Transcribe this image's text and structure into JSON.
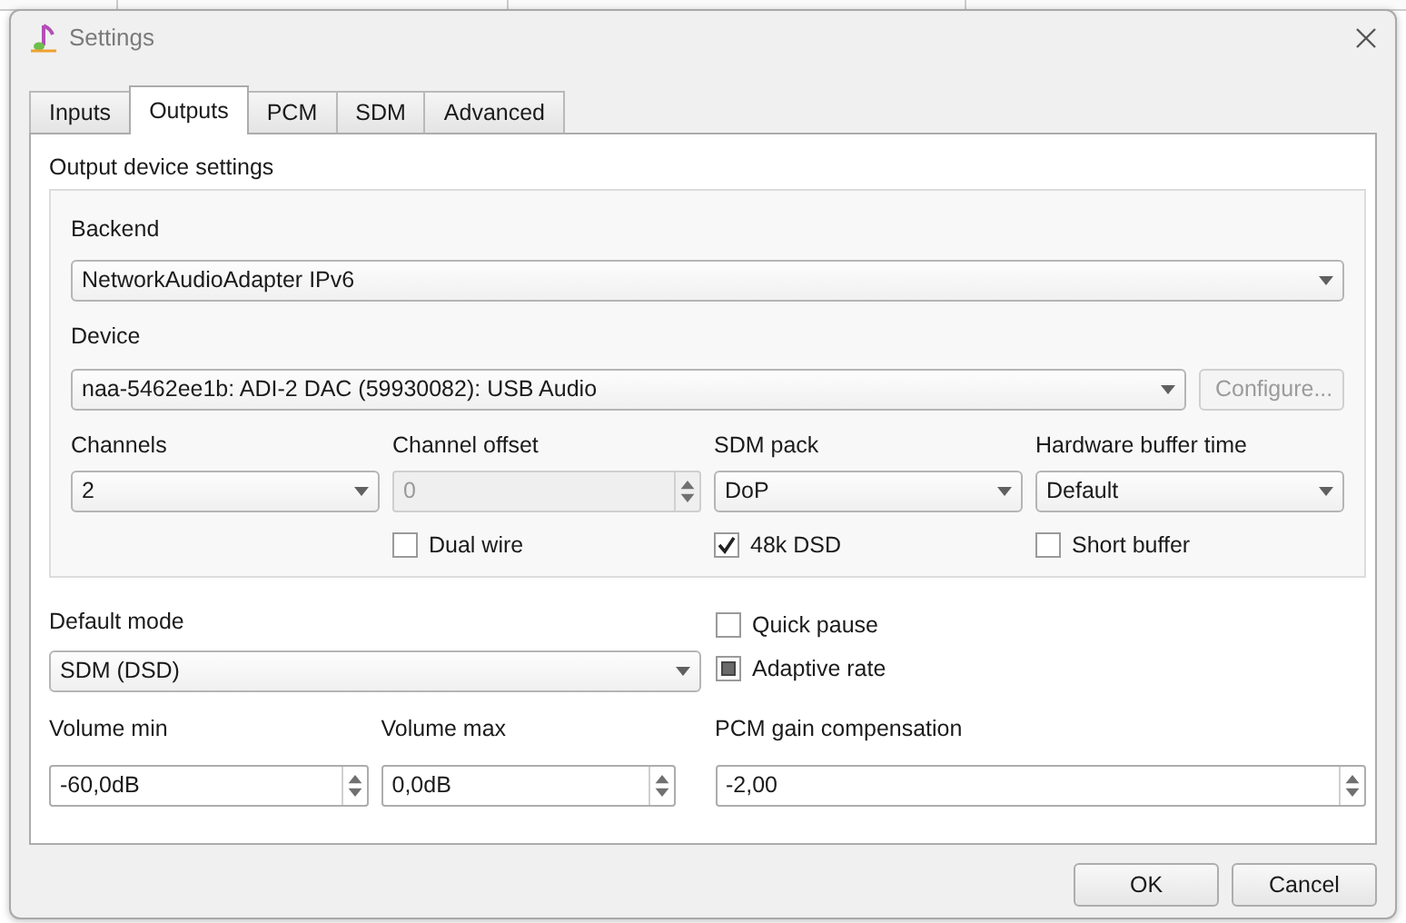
{
  "window": {
    "title": "Settings"
  },
  "tabs": [
    {
      "label": "Inputs",
      "selected": false
    },
    {
      "label": "Outputs",
      "selected": true
    },
    {
      "label": "PCM",
      "selected": false
    },
    {
      "label": "SDM",
      "selected": false
    },
    {
      "label": "Advanced",
      "selected": false
    }
  ],
  "output_device_settings": {
    "title": "Output device settings",
    "backend": {
      "label": "Backend",
      "value": "NetworkAudioAdapter IPv6"
    },
    "device": {
      "label": "Device",
      "value": "naa-5462ee1b: ADI-2 DAC (59930082): USB Audio"
    },
    "configure_button": {
      "label": "Configure...",
      "disabled": true
    },
    "columns": [
      {
        "label": "Channels",
        "kind": "dropdown",
        "value": "2",
        "disabled": false
      },
      {
        "label": "Channel offset",
        "kind": "spinbox",
        "value": "0",
        "disabled": true,
        "checkbox": {
          "label": "Dual wire",
          "checked": false
        }
      },
      {
        "label": "SDM pack",
        "kind": "dropdown",
        "value": "DoP",
        "disabled": false,
        "checkbox": {
          "label": "48k DSD",
          "checked": true
        }
      },
      {
        "label": "Hardware buffer time",
        "kind": "dropdown",
        "value": "Default",
        "disabled": false,
        "checkbox": {
          "label": "Short buffer",
          "checked": false
        }
      }
    ]
  },
  "default_mode": {
    "label": "Default mode",
    "value": "SDM (DSD)"
  },
  "options": [
    {
      "label": "Quick pause",
      "checked": false,
      "partially_checked": false
    },
    {
      "label": "Adaptive rate",
      "checked": false,
      "partially_checked": true
    }
  ],
  "levels": [
    {
      "label": "Volume min",
      "value": "-60,0dB"
    },
    {
      "label": "Volume max",
      "value": "0,0dB"
    },
    {
      "label": "PCM gain compensation",
      "value": "-2,00"
    }
  ],
  "buttons": [
    {
      "label": "OK"
    },
    {
      "label": "Cancel"
    }
  ]
}
